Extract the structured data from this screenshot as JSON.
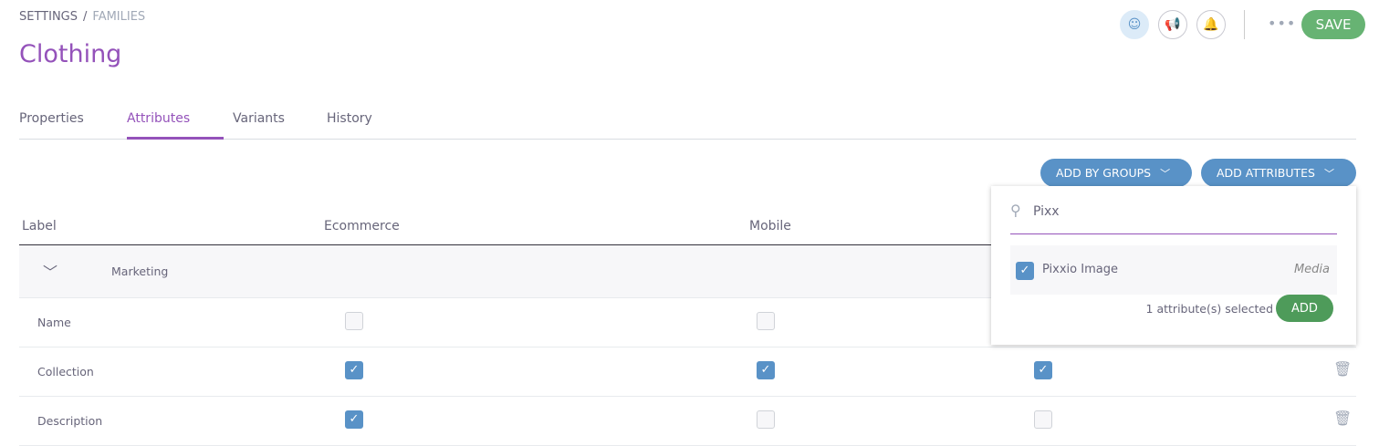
{
  "breadcrumb": {
    "items": [
      "SETTINGS",
      "FAMILIES"
    ],
    "separator": "/"
  },
  "title": "Clothing",
  "header": {
    "dots": "•••",
    "save_label": "SAVE",
    "icons": [
      "user-avatar-icon",
      "megaphone-icon",
      "bell-icon"
    ]
  },
  "tabs": [
    {
      "label": "Properties"
    },
    {
      "label": "Attributes",
      "active": true
    },
    {
      "label": "Variants"
    },
    {
      "label": "History"
    }
  ],
  "toolbar": {
    "add_by_groups": "ADD BY GROUPS",
    "add_attributes": "ADD ATTRIBUTES"
  },
  "table": {
    "columns": [
      "Label",
      "Ecommerce",
      "Mobile"
    ],
    "group": "Marketing",
    "rows": [
      {
        "label": "Name",
        "values": [
          false,
          false,
          false
        ]
      },
      {
        "label": "Collection",
        "values": [
          true,
          true,
          true
        ]
      },
      {
        "label": "Description",
        "values": [
          true,
          false,
          false
        ]
      }
    ]
  },
  "popup": {
    "search_value": "Pixx",
    "item": {
      "name": "Pixxio Image",
      "type": "Media",
      "checked": true
    },
    "selected_text": "1 attribute(s) selected",
    "add_label": "ADD"
  },
  "colors": {
    "accent": "#9452ba",
    "primary": "#5992c7",
    "success": "#67b373"
  }
}
